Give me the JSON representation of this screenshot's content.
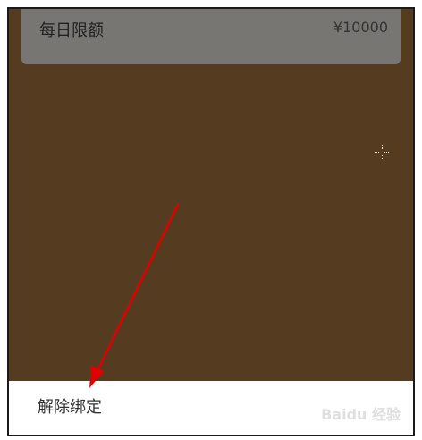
{
  "limit_row": {
    "label": "每日限额",
    "value": "¥10000"
  },
  "bottom_sheet": {
    "unbind_label": "解除绑定"
  },
  "watermark": {
    "text": "Baidu 经验"
  },
  "colors": {
    "overlay": "#553c21",
    "card": "#777672",
    "sheet": "#ffffff",
    "annotation_arrow": "#e00000"
  }
}
